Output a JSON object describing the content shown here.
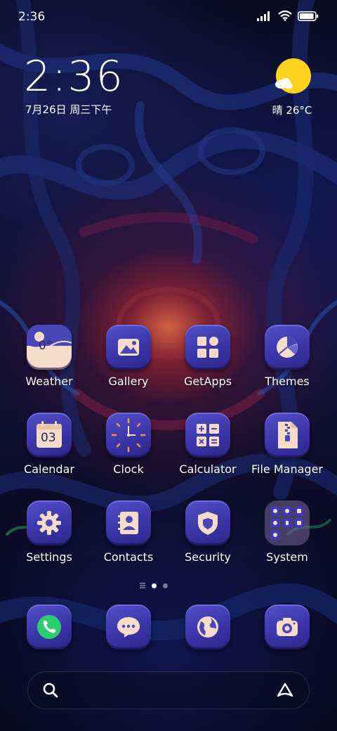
{
  "status_bar": {
    "time": "2:36",
    "battery_level": 0.9
  },
  "clock_widget": {
    "time": "2:36",
    "date": "7月26日 周三下午"
  },
  "weather_widget": {
    "text": "晴 26°C",
    "icon": "sun-cloud-icon"
  },
  "apps": {
    "weather": {
      "label": "Weather",
      "icon": "weather-icon",
      "icon_text": "0°"
    },
    "gallery": {
      "label": "Gallery",
      "icon": "gallery-icon"
    },
    "getapps": {
      "label": "GetApps",
      "icon": "getapps-icon"
    },
    "themes": {
      "label": "Themes",
      "icon": "themes-icon"
    },
    "calendar": {
      "label": "Calendar",
      "icon": "calendar-icon",
      "icon_text": "03"
    },
    "clock": {
      "label": "Clock",
      "icon": "clock-icon"
    },
    "calculator": {
      "label": "Calculator",
      "icon": "calculator-icon"
    },
    "file_manager": {
      "label": "File Manager",
      "icon": "file-manager-icon"
    },
    "settings": {
      "label": "Settings",
      "icon": "gear-icon"
    },
    "contacts": {
      "label": "Contacts",
      "icon": "contacts-icon"
    },
    "security": {
      "label": "Security",
      "icon": "shield-icon"
    },
    "system": {
      "label": "System",
      "icon": "folder-icon"
    }
  },
  "dock": {
    "phone": {
      "icon": "phone-icon"
    },
    "messages": {
      "icon": "messages-icon"
    },
    "browser": {
      "icon": "browser-icon"
    },
    "camera": {
      "icon": "camera-icon"
    }
  },
  "page_indicator": {
    "pages": 2,
    "current": 1
  },
  "search_bar": {
    "search_icon": "search-icon",
    "assistant_icon": "assistant-icon"
  },
  "colors": {
    "icon_bg": "#3b35a8",
    "icon_glyph": "#f4dcc8",
    "weather_sun": "#ffd21f",
    "phone_green": "#2ecc71"
  }
}
